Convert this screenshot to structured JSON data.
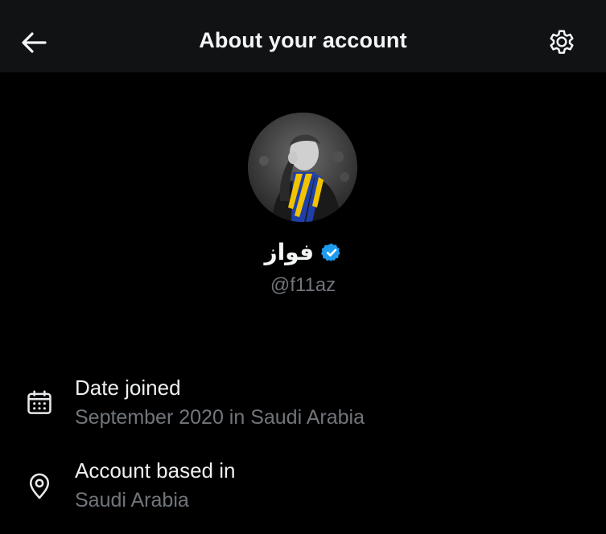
{
  "header": {
    "title": "About your account",
    "back_icon": "arrow-left-icon",
    "settings_icon": "gear-icon"
  },
  "profile": {
    "name": "فواز",
    "handle": "@f11az",
    "verified": true,
    "verified_color": "#1d9bf0",
    "avatar_scarf_colors": [
      "#f2c400",
      "#1f3fa8"
    ]
  },
  "details": [
    {
      "icon": "calendar-icon",
      "label": "Date joined",
      "value": "September 2020 in Saudi Arabia"
    },
    {
      "icon": "location-pin-icon",
      "label": "Account based in",
      "value": "Saudi Arabia"
    }
  ],
  "colors": {
    "background": "#000000",
    "header_background": "#111213",
    "primary_text": "#e7e9ea",
    "secondary_text": "#71767b"
  }
}
